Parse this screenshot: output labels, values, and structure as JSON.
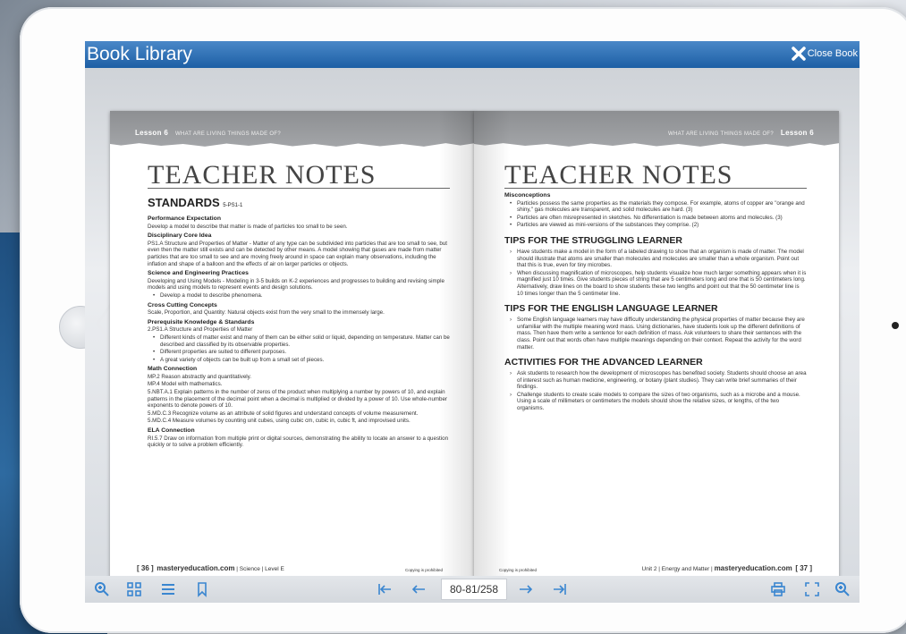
{
  "app": {
    "title": "Book Library",
    "close_label": "Close Book"
  },
  "toolbar": {
    "page_indicator": "80-81/258"
  },
  "left_page": {
    "lesson": "Lesson 6",
    "running_head": "WHAT ARE LIVING THINGS MADE OF?",
    "heading": "TEACHER NOTES",
    "standards_title": "STANDARDS",
    "standards_code": "5-PS1-1",
    "sections": [
      {
        "title": "Performance Expectation",
        "body": "Develop a model to describe that matter is made of particles too small to be seen."
      },
      {
        "title": "Disciplinary Core Idea",
        "body": "PS1.A Structure and Properties of Matter - Matter of any type can be subdivided into particles that are too small to see, but even then the matter still exists and can be detected by other means. A model showing that gases are made from matter particles that are too small to see and are moving freely around in space can explain many observations, including the inflation and shape of a balloon and the effects of air on larger particles or objects."
      },
      {
        "title": "Science and Engineering Practices",
        "body": "Developing and Using Models - Modeling in 3-5 builds on K-2 experiences and progresses to building and revising simple models and using models to represent events and design solutions."
      }
    ],
    "sep_bullet": "Develop a model to describe phenomena.",
    "crosscut_title": "Cross Cutting Concepts",
    "crosscut_body": "Scale, Proportion, and Quantity: Natural objects exist from the very small to the immensely large.",
    "prereq_title": "Prerequisite Knowledge & Standards",
    "prereq_body": "2.PS1.A Structure and Properties of Matter",
    "prereq_bullets": [
      "Different kinds of matter exist and many of them can be either solid or liquid, depending on temperature. Matter can be described and classified by its observable properties.",
      "Different properties are suited to different purposes.",
      "A great variety of objects can be built up from a small set of pieces."
    ],
    "math_title": "Math Connection",
    "math_lines": [
      "MP.2 Reason abstractly and quantitatively.",
      "MP.4 Model with mathematics.",
      "5.NBT.A.1 Explain patterns in the number of zeros of the product when multiplying a number by powers of 10, and explain patterns in the placement of the decimal point when a decimal is multiplied or divided by a power of 10. Use whole-number exponents to denote powers of 10.",
      "5.MD.C.3 Recognize volume as an attribute of solid figures and understand concepts of volume measurement.",
      "5.MD.C.4 Measure volumes by counting unit cubes, using cubic cm, cubic in, cubic ft, and improvised units."
    ],
    "ela_title": "ELA Connection",
    "ela_body": "RI.5.7 Draw on information from multiple print or digital sources, demonstrating the ability to locate an answer to a question quickly or to solve a problem efficiently.",
    "footer_page": "[ 36 ]",
    "footer_site": "masteryeducation.com",
    "footer_meta": "| Science | Level E",
    "footer_copy": "Copying is prohibited"
  },
  "right_page": {
    "lesson": "Lesson 6",
    "running_head": "WHAT ARE LIVING THINGS MADE OF?",
    "heading": "TEACHER NOTES",
    "misconceptions_title": "Misconceptions",
    "misconceptions": [
      "Particles possess the same properties as the materials they compose. For example, atoms of copper are \"orange and shiny,\" gas molecules are transparent, and solid molecules are hard. (3)",
      "Particles are often misrepresented in sketches. No differentiation is made between atoms and molecules. (3)",
      "Particles are viewed as mini-versions of the substances they comprise. (2)"
    ],
    "struggling_title": "TIPS FOR THE STRUGGLING LEARNER",
    "struggling": [
      "Have students make a model in the form of a labeled drawing to show that an organism is made of matter. The model should illustrate that atoms are smaller than molecules and molecules are smaller than a whole organism. Point out that this is true, even for tiny microbes.",
      "When discussing magnification of microscopes, help students visualize how much larger something appears when it is magnified just 10 times. Give students pieces of string that are 5 centimeters long and one that is 50 centimeters long. Alternatively, draw lines on the board to show students these two lengths and point out that the 50 centimeter line is 10 times longer than the 5 centimeter line."
    ],
    "ell_title": "TIPS FOR THE ENGLISH LANGUAGE LEARNER",
    "ell": [
      "Some English language learners may have difficulty understanding the physical properties of matter because they are unfamiliar with the multiple meaning word mass. Using dictionaries, have students look up the different definitions of mass. Then have them write a sentence for each definition of mass. Ask volunteers to share their sentences with the class. Point out that words often have multiple meanings depending on their context. Repeat the activity for the word matter."
    ],
    "advanced_title": "ACTIVITIES FOR THE ADVANCED LEARNER",
    "advanced": [
      "Ask students to research how the development of microscopes has benefited society. Students should choose an area of interest such as human medicine, engineering, or botany (plant studies). They can write brief summaries of their findings.",
      "Challenge students to create scale models to compare the sizes of two organisms, such as a microbe and a mouse. Using a scale of millimeters or centimeters the models should show the relative sizes, or lengths, of the two organisms."
    ],
    "footer_copy": "Copying is prohibited",
    "footer_meta": "Unit 2 | Energy and Matter |",
    "footer_site": "masteryeducation.com",
    "footer_page": "[ 37 ]"
  }
}
